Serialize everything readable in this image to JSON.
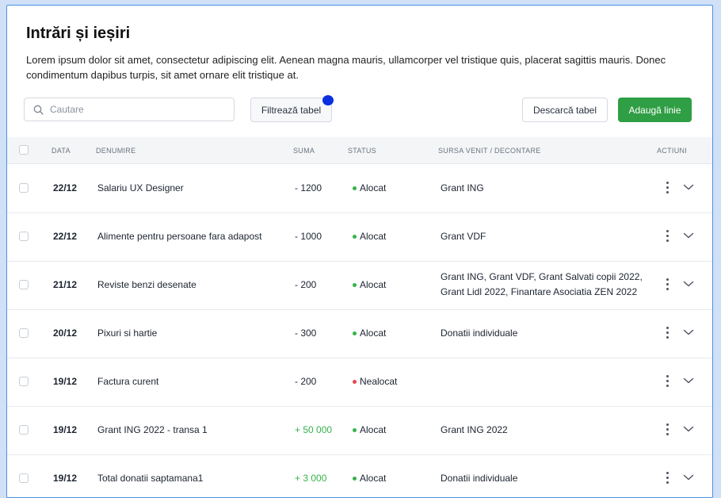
{
  "header": {
    "title": "Intrări și ieșiri",
    "description": "Lorem ipsum dolor sit amet, consectetur adipiscing elit. Aenean magna mauris, ullamcorper vel tristique quis, placerat sagittis mauris. Donec condimentum dapibus turpis, sit amet ornare elit tristique at."
  },
  "toolbar": {
    "search_placeholder": "Cautare",
    "filter_label": "Filtrează tabel",
    "download_label": "Descarcă tabel",
    "add_label": "Adaugă linie"
  },
  "colors": {
    "accent": "#2f9e44",
    "positive": "#35b34a",
    "allocated": "#35b34a",
    "unallocated": "#e5484d",
    "badge": "#0b2fe0"
  },
  "table": {
    "columns": [
      "DATA",
      "DENUMIRE",
      "SUMA",
      "STATUS",
      "SURSA VENIT / DECONTARE",
      "ACTIUNI"
    ],
    "rows": [
      {
        "date": "22/12",
        "name": "Salariu UX Designer",
        "sum": "- 1200",
        "status": "Alocat",
        "source": "Grant ING"
      },
      {
        "date": "22/12",
        "name": "Alimente pentru persoane fara adapost",
        "sum": "- 1000",
        "status": "Alocat",
        "source": "Grant VDF"
      },
      {
        "date": "21/12",
        "name": "Reviste benzi desenate",
        "sum": "- 200",
        "status": "Alocat",
        "source": "Grant ING, Grant VDF, Grant Salvati copii 2022, Grant Lidl 2022, Finantare Asociatia ZEN 2022"
      },
      {
        "date": "20/12",
        "name": "Pixuri si hartie",
        "sum": "- 300",
        "status": "Alocat",
        "source": "Donatii individuale"
      },
      {
        "date": "19/12",
        "name": "Factura curent",
        "sum": "- 200",
        "status": "Nealocat",
        "source": ""
      },
      {
        "date": "19/12",
        "name": "Grant ING 2022 - transa 1",
        "sum": "+ 50 000",
        "status": "Alocat",
        "source": "Grant ING 2022"
      },
      {
        "date": "19/12",
        "name": "Total donatii saptamana1",
        "sum": "+ 3 000",
        "status": "Alocat",
        "source": "Donatii individuale"
      }
    ]
  },
  "icons": {
    "search": "search-icon",
    "row_menu": "kebab-menu-icon",
    "row_expand": "chevron-down-icon"
  }
}
